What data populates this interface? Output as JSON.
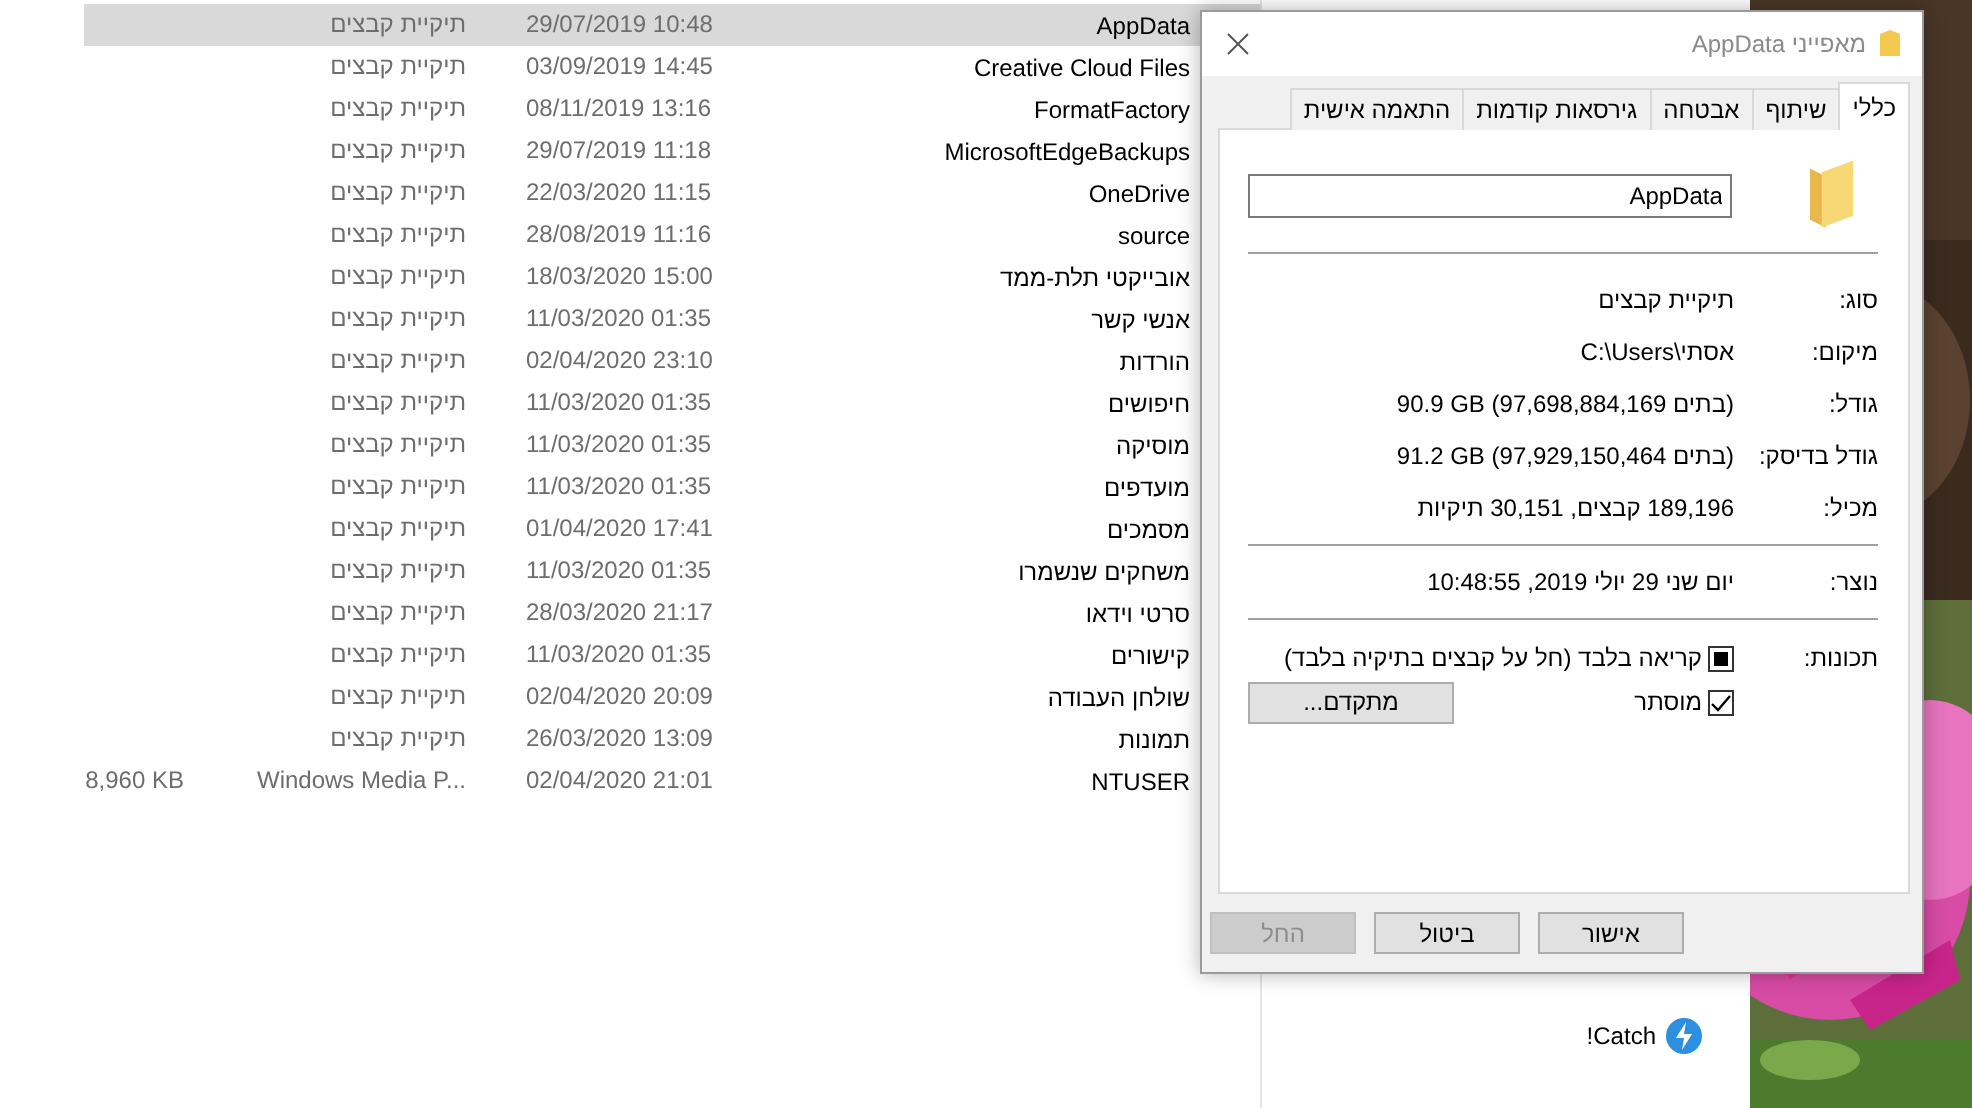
{
  "file_list": {
    "rows": [
      {
        "name": "AppData",
        "date": "29/07/2019 10:48",
        "type": "תיקיית קבצים",
        "selected": true
      },
      {
        "name": "Creative Cloud Files",
        "date": "03/09/2019 14:45",
        "type": "תיקיית קבצים",
        "selected": false
      },
      {
        "name": "FormatFactory",
        "date": "08/11/2019 13:16",
        "type": "תיקיית קבצים",
        "selected": false
      },
      {
        "name": "MicrosoftEdgeBackups",
        "date": "29/07/2019 11:18",
        "type": "תיקיית קבצים",
        "selected": false
      },
      {
        "name": "OneDrive",
        "date": "22/03/2020 11:15",
        "type": "תיקיית קבצים",
        "selected": false
      },
      {
        "name": "source",
        "date": "28/08/2019 11:16",
        "type": "תיקיית קבצים",
        "selected": false
      },
      {
        "name": "אובייקטי תלת-ממד",
        "date": "18/03/2020 15:00",
        "type": "תיקיית קבצים",
        "selected": false
      },
      {
        "name": "אנשי קשר",
        "date": "11/03/2020 01:35",
        "type": "תיקיית קבצים",
        "selected": false
      },
      {
        "name": "הורדות",
        "date": "02/04/2020 23:10",
        "type": "תיקיית קבצים",
        "selected": false
      },
      {
        "name": "חיפושים",
        "date": "11/03/2020 01:35",
        "type": "תיקיית קבצים",
        "selected": false
      },
      {
        "name": "מוסיקה",
        "date": "11/03/2020 01:35",
        "type": "תיקיית קבצים",
        "selected": false
      },
      {
        "name": "מועדפים",
        "date": "11/03/2020 01:35",
        "type": "תיקיית קבצים",
        "selected": false
      },
      {
        "name": "מסמכים",
        "date": "01/04/2020 17:41",
        "type": "תיקיית קבצים",
        "selected": false
      },
      {
        "name": "משחקים שנשמרו",
        "date": "11/03/2020 01:35",
        "type": "תיקיית קבצים",
        "selected": false
      },
      {
        "name": "סרטי וידאו",
        "date": "28/03/2020 21:17",
        "type": "תיקיית קבצים",
        "selected": false
      },
      {
        "name": "קישורים",
        "date": "11/03/2020 01:35",
        "type": "תיקיית קבצים",
        "selected": false
      },
      {
        "name": "שולחן העבודה",
        "date": "02/04/2020 20:09",
        "type": "תיקיית קבצים",
        "selected": false
      },
      {
        "name": "תמונות",
        "date": "26/03/2020 13:09",
        "type": "תיקיית קבצים",
        "selected": false
      },
      {
        "name": "NTUSER",
        "date": "02/04/2020 21:01",
        "type": "Windows Media P...",
        "size": "8,960 KB",
        "selected": false
      }
    ]
  },
  "nav_pane": {
    "items": [
      {
        "label": "Catch!",
        "kind": "catch"
      }
    ]
  },
  "dialog": {
    "title": "מאפייני AppData",
    "tabs": [
      {
        "label": "כללי",
        "selected": true
      },
      {
        "label": "שיתוף",
        "selected": false
      },
      {
        "label": "אבטחה",
        "selected": false
      },
      {
        "label": "גירסאות קודמות",
        "selected": false
      },
      {
        "label": "התאמה אישית",
        "selected": false
      }
    ],
    "name_field": {
      "value": "AppData"
    },
    "detail_groups": [
      [
        {
          "label": "סוג:",
          "value": "תיקיית קבצים"
        },
        {
          "label": "מיקום:",
          "value": "C:\\Users\\אסתי"
        },
        {
          "label": "גודל:",
          "value": "90.9 GB (97,698,884,169 בתים)"
        },
        {
          "label": "גודל בדיסק:",
          "value": "91.2 GB (97,929,150,464 בתים)"
        },
        {
          "label": "מכיל:",
          "value": "189,196 קבצים, 30,151 תיקיות"
        }
      ],
      [
        {
          "label": "נוצר:",
          "value": "יום שני 29 יולי 2019, 10:48:55"
        }
      ]
    ],
    "attributes": {
      "label": "תכונות:",
      "options": [
        {
          "label": "קריאה בלבד (חל על קבצים בתיקיה בלבד)",
          "checked": true,
          "indeterminate": true
        },
        {
          "label": "מוסתר",
          "checked": true
        }
      ],
      "advanced_button": "מתקדם..."
    },
    "buttons": [
      {
        "label": "אישור",
        "disabled": false
      },
      {
        "label": "ביטול",
        "disabled": false
      },
      {
        "label": "החל",
        "disabled": true
      }
    ]
  }
}
